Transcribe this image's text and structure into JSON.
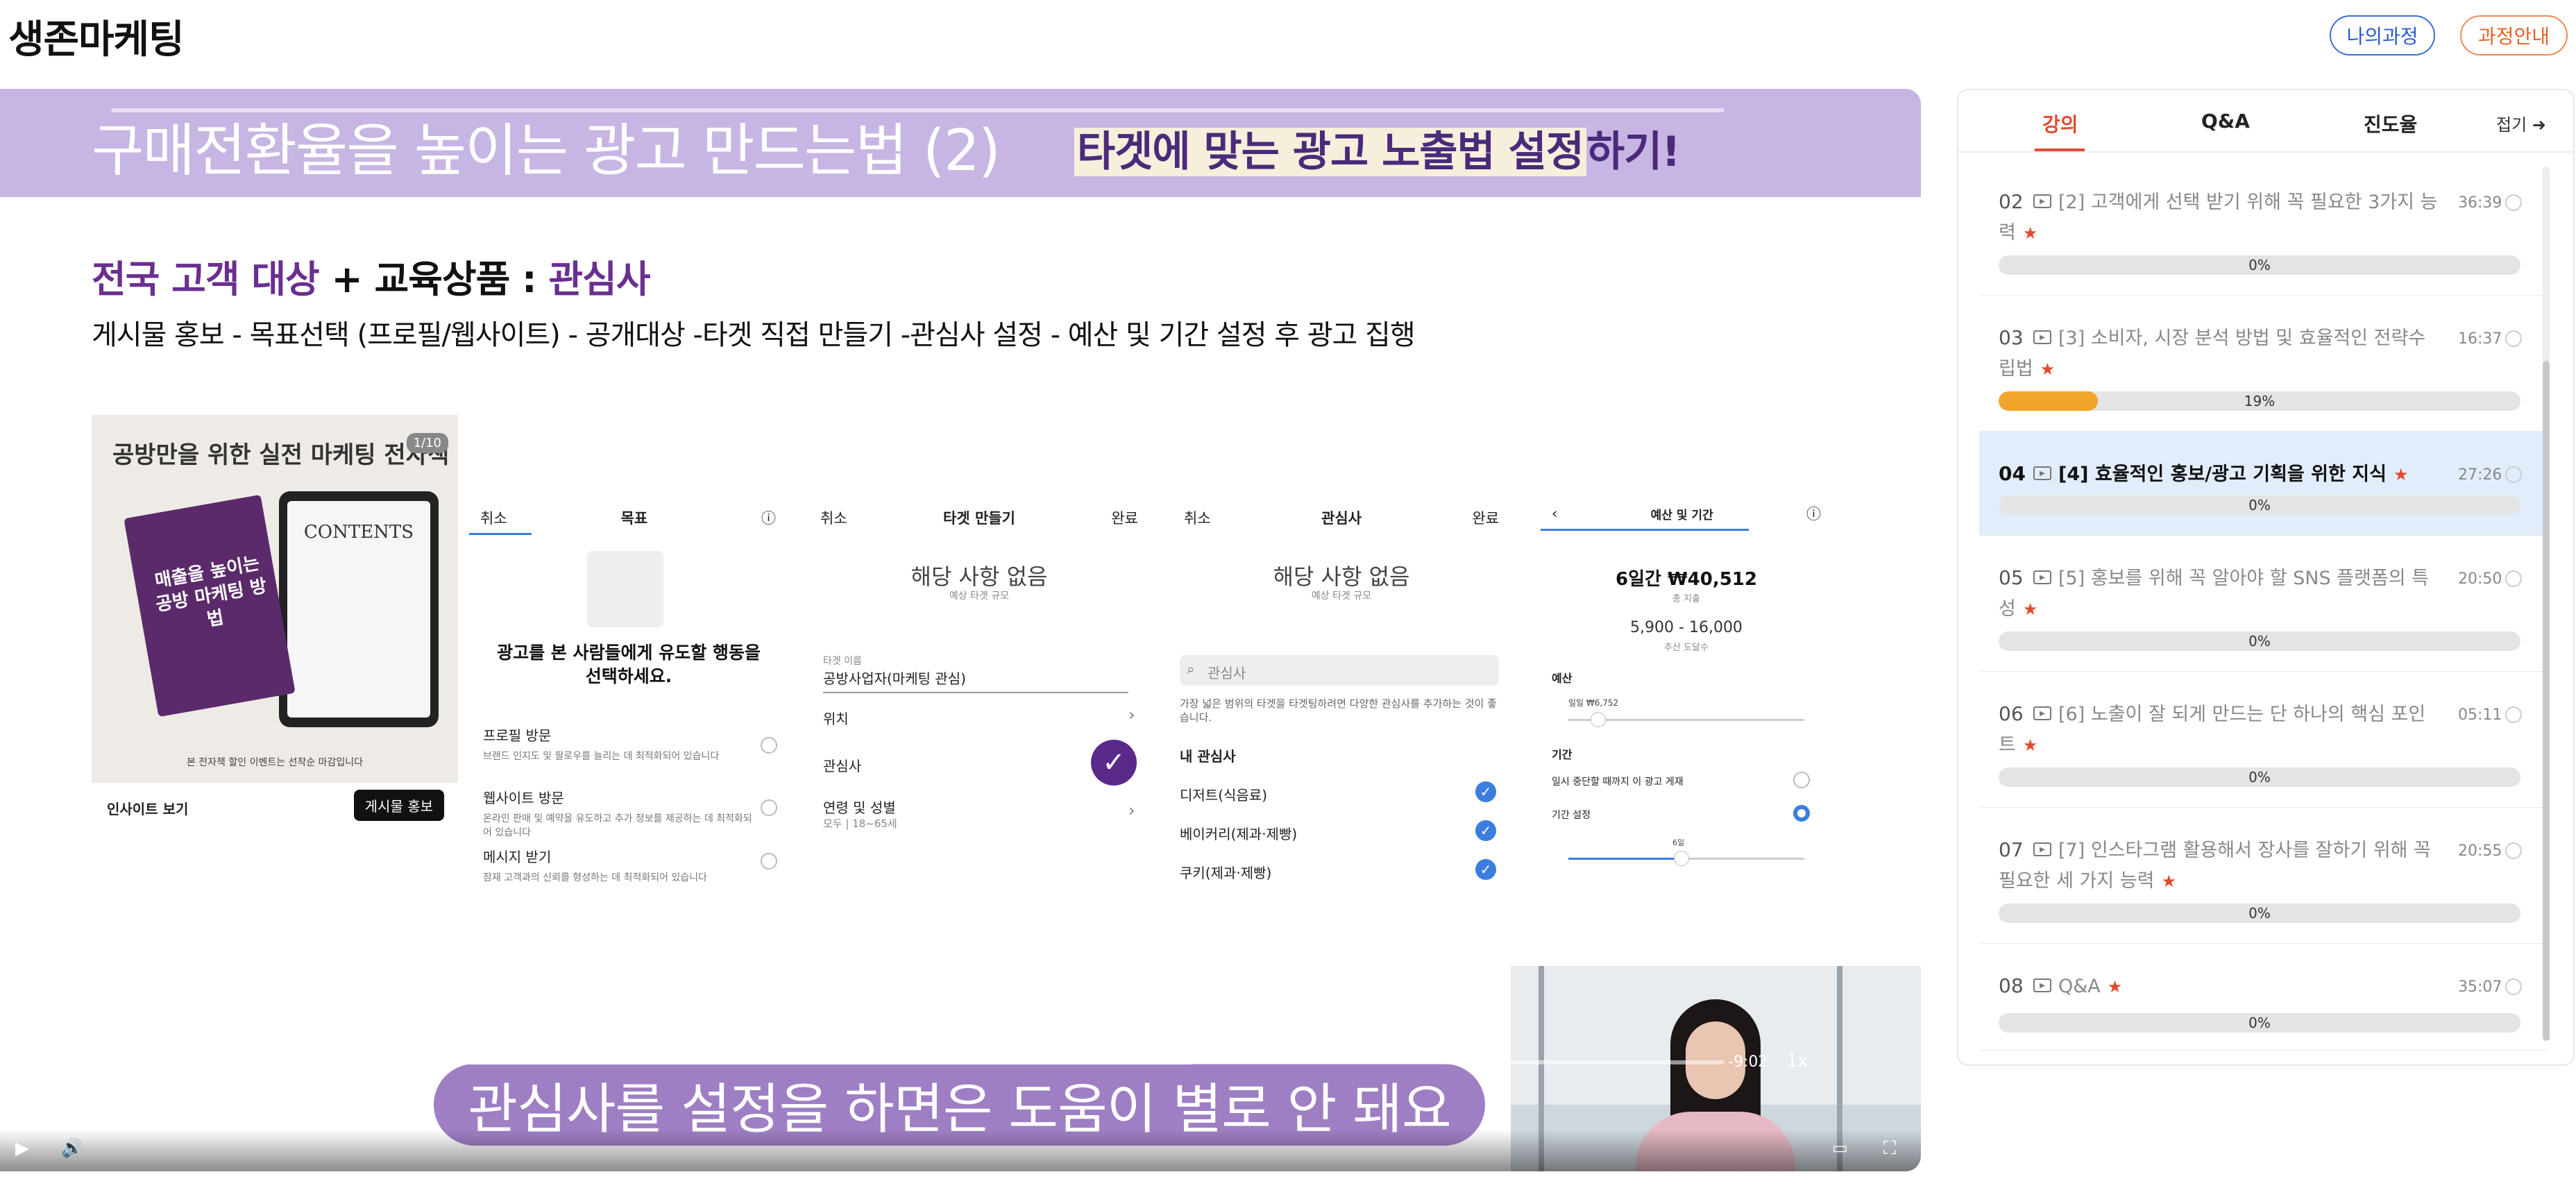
{
  "brand": "생존마케팅",
  "header": {
    "my_course": "나의과정",
    "course_info": "과정안내"
  },
  "slide": {
    "title": "구매전환율을 높이는 광고 만드는법 (2)",
    "title_highlight": "타겟에 맞는 광고 노출법 설정",
    "title_tail": "하기!",
    "subhead_purple": "전국 고객 대상",
    "subhead_mid": " + 교육상품 : ",
    "subhead_tail": "관심사",
    "description": "게시물 홍보 - 목표선택 (프로필/웹사이트) - 공개대상 -타겟 직접 만들기 -관심사 설정 - 예산 및 기간 설정 후 광고 집행",
    "shot1": {
      "cover_title": "공방만을 위한 실전 마케팅 전자책",
      "page_count": "1/10",
      "book_text": "매출을 높이는 공방 마케팅 방법",
      "contents": "CONTENTS",
      "caption": "본 전자책 할인 이벤트는 선착순 마감입니다",
      "insight": "인사이트 보기",
      "post_button": "게시물 홍보"
    },
    "shot2": {
      "tab_cancel": "취소",
      "tab_goal": "목표",
      "info_icon": "info-icon",
      "heading": "광고를 본 사람들에게 유도할 행동을 선택하세요.",
      "options": [
        {
          "title": "프로필 방문",
          "desc": "브랜드 인지도 및 팔로우를 늘리는 데 최적화되어 있습니다"
        },
        {
          "title": "웹사이트 방문",
          "desc": "온라인 판매 및 예약을 유도하고 추가 정보를 제공하는 데 최적화되어 있습니다"
        },
        {
          "title": "메시지 받기",
          "desc": "잠재 고객과의 신뢰를 형성하는 데 최적화되어 있습니다"
        }
      ]
    },
    "shot3": {
      "cancel": "취소",
      "title": "타겟 만들기",
      "done": "완료",
      "empty": "해당 사항 없음",
      "empty_sub": "예상 타겟 규모",
      "name_label": "타겟 이름",
      "name_value": "공방사업자(마케팅 관심)",
      "location": "위치",
      "interest": "관심사",
      "age_gender": "연령 및 성별",
      "age_gender_value": "모두 | 18~65세"
    },
    "shot4": {
      "cancel": "취소",
      "title": "관심사",
      "done": "완료",
      "empty": "해당 사항 없음",
      "empty_sub": "예상 타겟 규모",
      "search_placeholder": "관심사",
      "hint": "가장 넓은 범위의 타겟을 타겟팅하려면 다양한 관심사를 추가하는 것이 좋습니다.",
      "my_interests": "내 관심사",
      "items": [
        "디저트(식음료)",
        "베이커리(제과·제빵)",
        "쿠키(제과·제빵)"
      ]
    },
    "shot5": {
      "title": "예산 및 기간",
      "total": "6일간 ₩40,512",
      "total_label": "총 지출",
      "reach": "5,900 - 16,000",
      "reach_label": "추산 도달수",
      "budget": "예산",
      "daily": "일일 ₩6,752",
      "period": "기간",
      "pause_option": "일시 중단할 때까지 이 광고 게재",
      "set_period": "기간 설정",
      "days": "6일"
    }
  },
  "caption": "관심사를 설정을 하면은 도움이 별로 안 돼요",
  "player": {
    "time": "-9:02",
    "speed": "1x",
    "progress": 0.67
  },
  "panel": {
    "tabs": [
      "강의",
      "Q&A",
      "진도율"
    ],
    "collapse": "접기 ➜",
    "lessons": [
      {
        "num": "02",
        "title": "[2] 고객에게 선택 받기 위해 꼭 필요한 3가지 능력",
        "dur": "36:39",
        "pct": "0%",
        "progress": 0.0,
        "active": false
      },
      {
        "num": "03",
        "title": "[3] 소비자, 시장 분석 방법 및 효율적인 전략수립법",
        "dur": "16:37",
        "pct": "19%",
        "progress": 0.19,
        "active": false
      },
      {
        "num": "04",
        "title": "[4] 효율적인 홍보/광고 기획을 위한 지식",
        "dur": "27:26",
        "pct": "0%",
        "progress": 0.0,
        "active": true
      },
      {
        "num": "05",
        "title": "[5] 홍보를 위해 꼭 알아야 할 SNS 플랫폼의 특성",
        "dur": "20:50",
        "pct": "0%",
        "progress": 0.0,
        "active": false
      },
      {
        "num": "06",
        "title": "[6] 노출이 잘 되게 만드는 단 하나의 핵심 포인트",
        "dur": "05:11",
        "pct": "0%",
        "progress": 0.0,
        "active": false
      },
      {
        "num": "07",
        "title": "[7] 인스타그램 활용해서 장사를 잘하기 위해 꼭 필요한 세 가지 능력",
        "dur": "20:55",
        "pct": "0%",
        "progress": 0.0,
        "active": false
      },
      {
        "num": "08",
        "title": "Q&A",
        "dur": "35:07",
        "pct": "0%",
        "progress": 0.0,
        "active": false
      }
    ]
  },
  "colors": {
    "accent": "#e24a2e",
    "progress": "#f1a52b",
    "slide_band": "#c7b6e3",
    "caption_bg": "#9e7fc3",
    "active_row": "#e2edfb"
  }
}
